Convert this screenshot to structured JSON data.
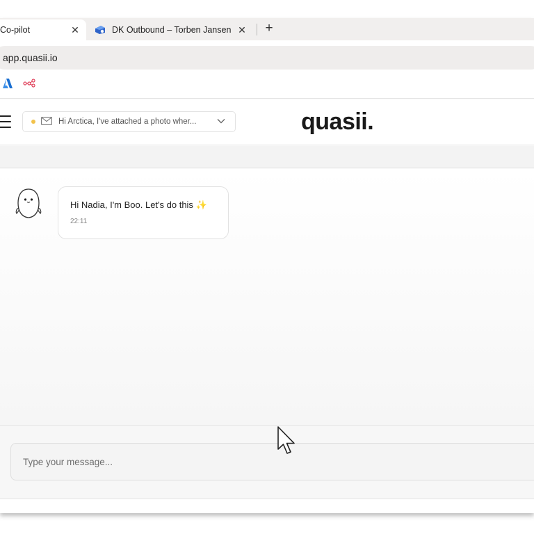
{
  "browser": {
    "tabs": [
      {
        "label": "Co-pilot",
        "close": "✕",
        "active": true
      },
      {
        "label": "DK Outbound – Torben Jansen",
        "close": "✕",
        "active": false
      }
    ],
    "new_tab": "+",
    "url": "app.quasii.io"
  },
  "bookmarks": [
    {
      "icon": "azure-icon",
      "color": "#1a6fd1"
    },
    {
      "icon": "workflow-icon",
      "color": "#e0445d"
    }
  ],
  "header": {
    "thread_preview": "Hi Arctica, I've attached a photo wher...",
    "status_color": "#f2c24b",
    "brand": "quasii."
  },
  "chat": {
    "messages": [
      {
        "text": "Hi Nadia, I'm Boo. Let's do this",
        "emoji": "✨",
        "time": "22:11",
        "sender_icon": "ghost-avatar-icon"
      }
    ]
  },
  "composer": {
    "placeholder": "Type your message..."
  }
}
